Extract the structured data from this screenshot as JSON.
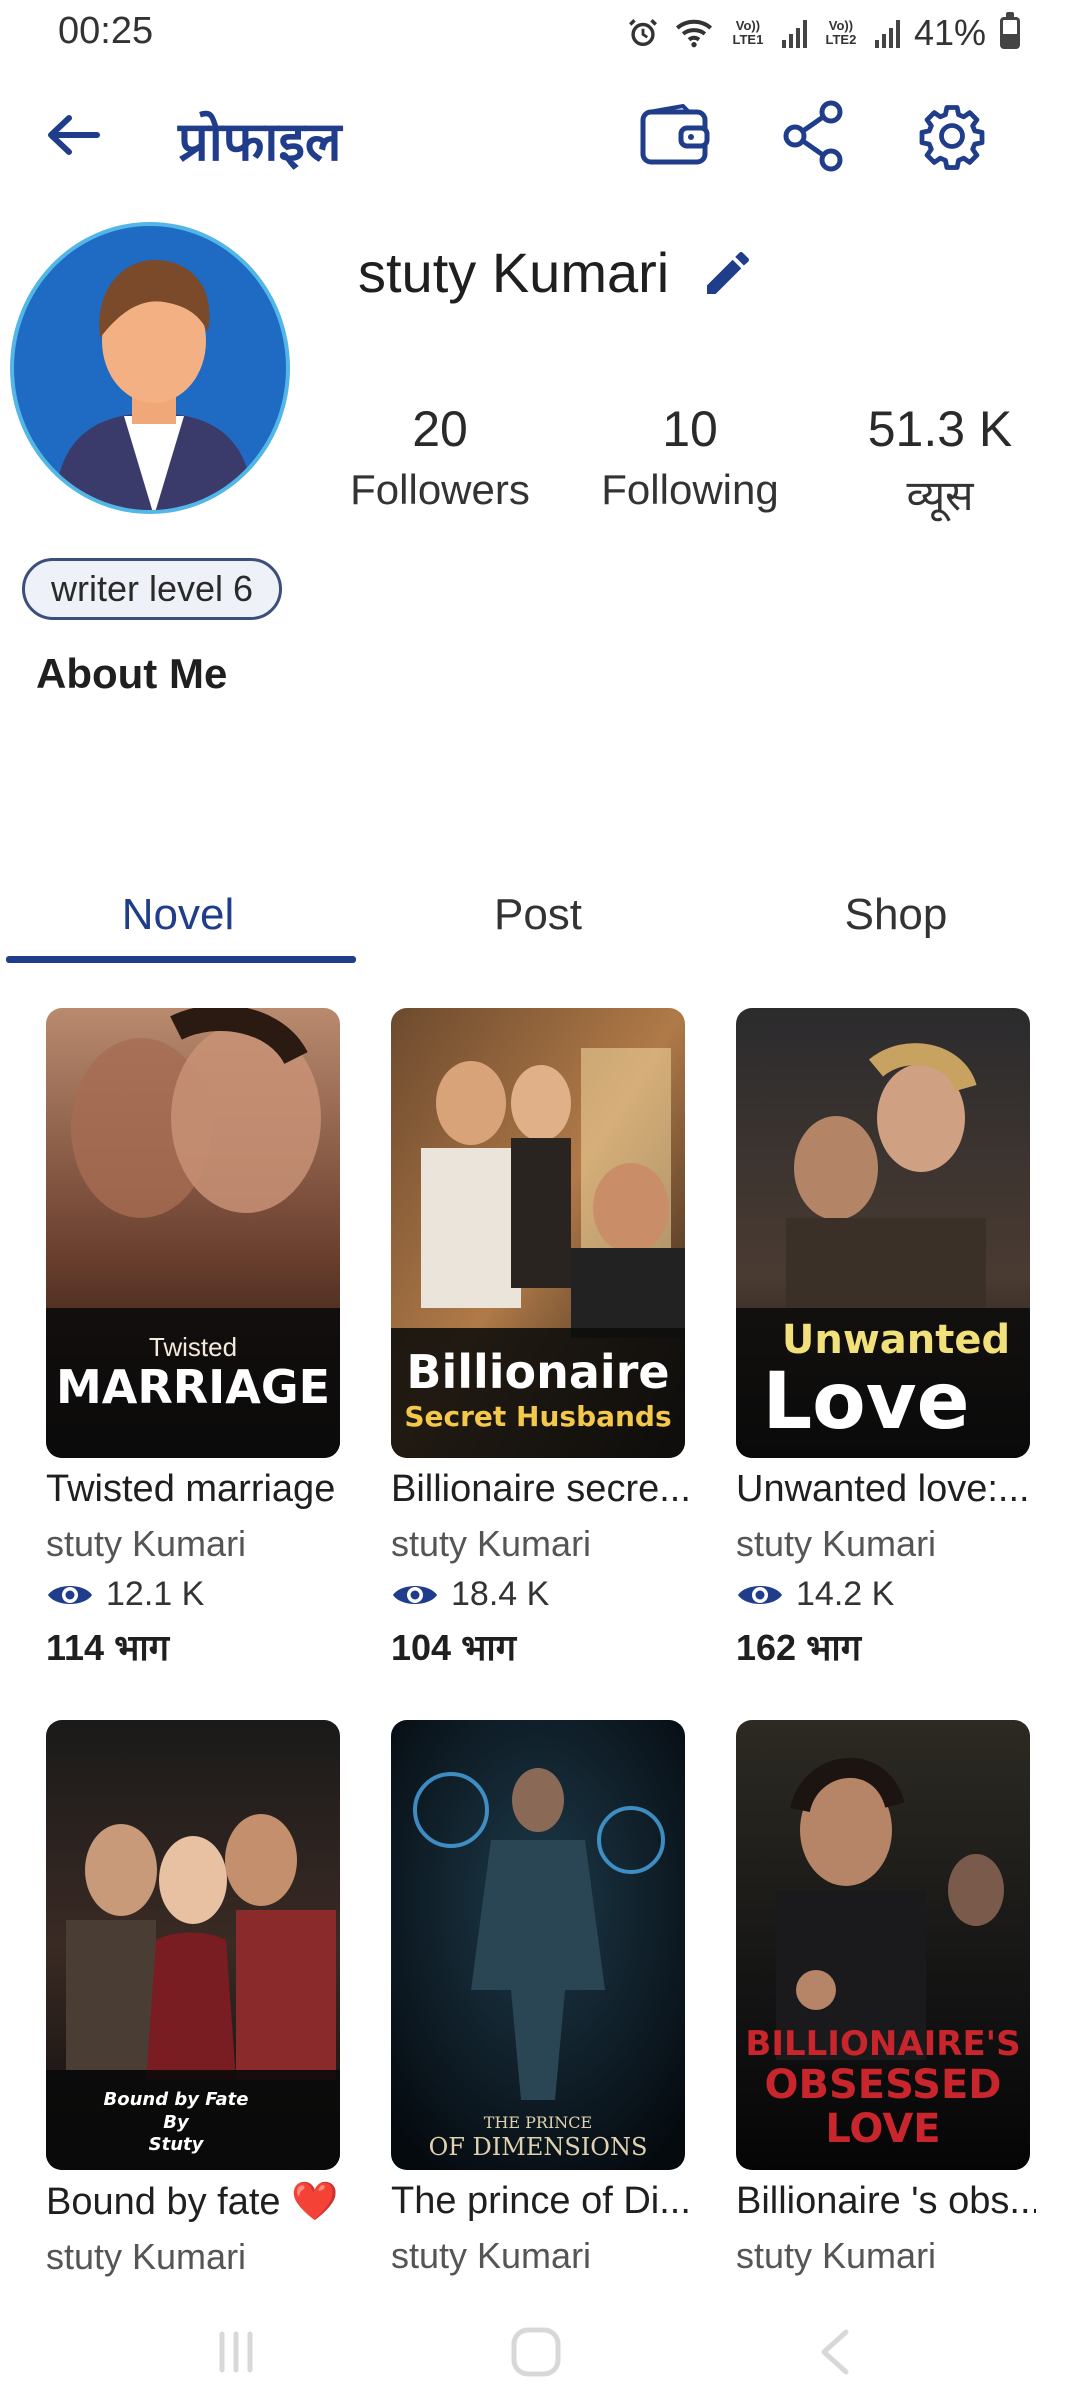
{
  "status_bar": {
    "time": "00:25",
    "lte1": "Vo)) LTE1",
    "lte2": "Vo)) LTE2",
    "battery": "41%",
    "battery_level": 0.41
  },
  "header": {
    "title": "प्रोफाइल",
    "icons": [
      "back-arrow-icon",
      "wallet-icon",
      "share-icon",
      "gear-icon"
    ]
  },
  "profile": {
    "name": "stuty Kumari",
    "stats": [
      {
        "value": "20",
        "label": "Followers"
      },
      {
        "value": "10",
        "label": "Following"
      },
      {
        "value": "51.3 K",
        "label": "व्यूस"
      }
    ],
    "level": "writer level 6",
    "about_title": "About Me"
  },
  "tabs": [
    {
      "label": "Novel",
      "active": true
    },
    {
      "label": "Post",
      "active": false
    },
    {
      "label": "Shop",
      "active": false
    }
  ],
  "books": [
    {
      "title": "Twisted marriage",
      "author": "stuty Kumari",
      "views": "12.1 K",
      "parts": "114 भाग",
      "cover_top": "Twisted",
      "cover_main": "MARRIAGE"
    },
    {
      "title": "Billionaire secre...",
      "author": "stuty Kumari",
      "views": "18.4 K",
      "parts": "104 भाग",
      "cover_top": "Billionaire",
      "cover_main": "Secret Husbands"
    },
    {
      "title": "Unwanted love:...",
      "author": "stuty Kumari",
      "views": "14.2 K",
      "parts": "162 भाग",
      "cover_top": "Unwanted",
      "cover_main": "Love"
    },
    {
      "title": "Bound by fate ❤️",
      "author": "stuty Kumari",
      "cover_top": "Bound by  Fate",
      "cover_main": "By\nStuty"
    },
    {
      "title": "The prince  of Di...",
      "author": "stuty Kumari",
      "cover_top": "THE PRINCE",
      "cover_main": "OF DIMENSIONS"
    },
    {
      "title": "Billionaire 's obs...",
      "author": "stuty Kumari",
      "cover_top": "BILLIONAIRE'S",
      "cover_main": "OBSESSED\nLOVE"
    }
  ],
  "colors": {
    "accent": "#1f3d8a",
    "avatar_bg": "#1f6bc4",
    "avatar_ring": "#52b6e6"
  }
}
